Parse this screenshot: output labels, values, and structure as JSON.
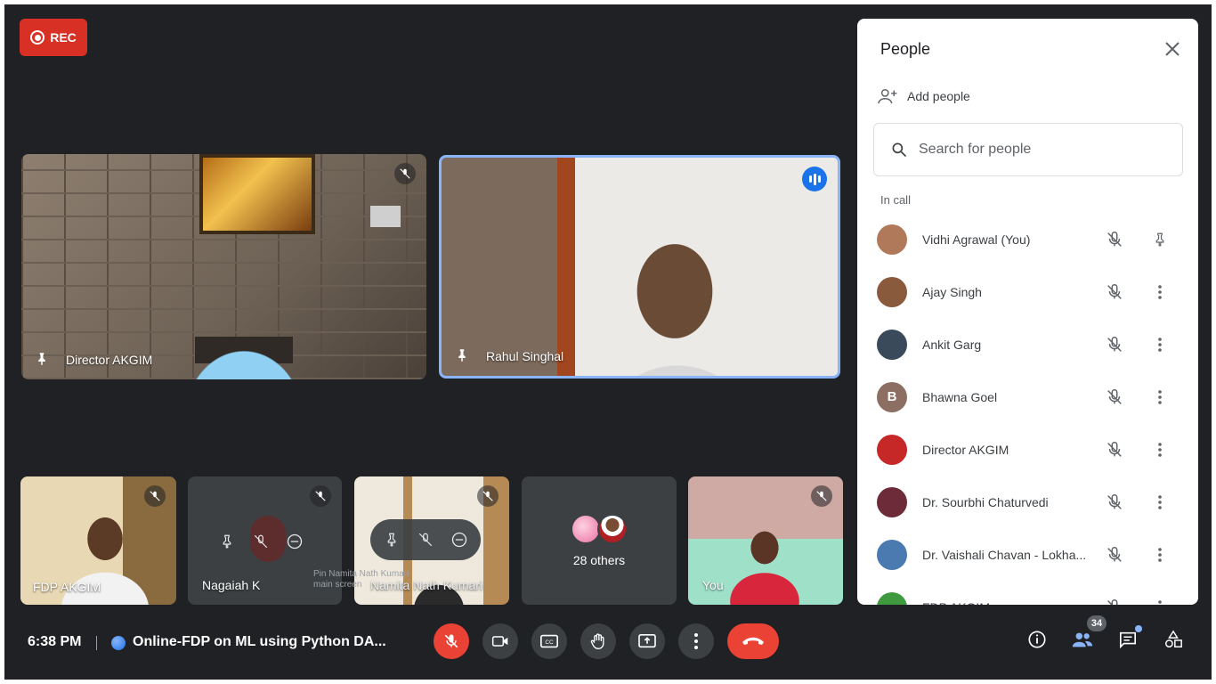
{
  "recording": {
    "label": "REC"
  },
  "stage": {
    "main_tiles": [
      {
        "name": "Director AKGIM"
      },
      {
        "name": "Rahul Singhal"
      }
    ],
    "small_tiles": [
      {
        "name": "FDP AKGIM"
      },
      {
        "name": "Nagaiah K"
      },
      {
        "name": "Namita Nath Kumari",
        "tooltip_line1": "Pin Namita Nath Kumari",
        "tooltip_line2": "main screen"
      },
      {
        "label": "28 others"
      },
      {
        "name": "You"
      }
    ]
  },
  "bottom_bar": {
    "time": "6:38 PM",
    "meeting_title": "Online-FDP on ML using Python DA...",
    "participants_count": "34"
  },
  "people_panel": {
    "title": "People",
    "add_people": "Add people",
    "search_placeholder": "Search for people",
    "section_label": "In call",
    "participants": [
      {
        "name": "Vidhi Agrawal (You)",
        "avatar_color": "#b07a5a",
        "initial": ""
      },
      {
        "name": "Ajay Singh",
        "avatar_color": "#8a5a3c",
        "initial": ""
      },
      {
        "name": "Ankit Garg",
        "avatar_color": "#3a4a5a",
        "initial": ""
      },
      {
        "name": "Bhawna Goel",
        "avatar_color": "#8d6e63",
        "initial": "B"
      },
      {
        "name": "Director AKGIM",
        "avatar_color": "#c62828",
        "initial": ""
      },
      {
        "name": "Dr. Sourbhi Chaturvedi",
        "avatar_color": "#6d2b3a",
        "initial": ""
      },
      {
        "name": "Dr. Vaishali Chavan - Lokha...",
        "avatar_color": "#4a7ab0",
        "initial": ""
      },
      {
        "name": "FDP AKGIM",
        "avatar_color": "#3f9a3f",
        "initial": ""
      }
    ]
  },
  "colors": {
    "accent": "#1a73e8",
    "danger": "#ea4335",
    "background": "#202124"
  }
}
